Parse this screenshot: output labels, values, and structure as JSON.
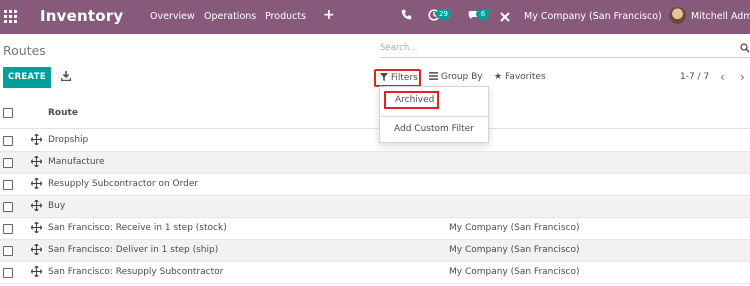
{
  "navbar": {
    "app_name": "Inventory",
    "menu": [
      "Overview",
      "Operations",
      "Products"
    ],
    "plus_label": "+",
    "activity_count": "29",
    "message_count": "6",
    "company": "My Company (San Francisco)",
    "user": "Mitchell Admin"
  },
  "control_panel": {
    "breadcrumb": "Routes",
    "search_placeholder": "Search...",
    "create_label": "CREATE",
    "filters_label": "Filters",
    "groupby_label": "Group By",
    "favorites_label": "Favorites",
    "pager": "1-7 / 7"
  },
  "filters_dropdown": {
    "archived": "Archived",
    "add_custom": "Add Custom Filter"
  },
  "table": {
    "column_route": "Route",
    "rows": [
      {
        "route": "Dropship",
        "company": ""
      },
      {
        "route": "Manufacture",
        "company": ""
      },
      {
        "route": "Resupply Subcontractor on Order",
        "company": ""
      },
      {
        "route": "Buy",
        "company": ""
      },
      {
        "route": "San Francisco: Receive in 1 step (stock)",
        "company": "My Company (San Francisco)"
      },
      {
        "route": "San Francisco: Deliver in 1 step (ship)",
        "company": "My Company (San Francisco)"
      },
      {
        "route": "San Francisco: Resupply Subcontractor",
        "company": "My Company (San Francisco)"
      }
    ]
  },
  "colors": {
    "navbar": "#875a7b",
    "primary": "#00a09d",
    "highlight": "#e0232b"
  }
}
